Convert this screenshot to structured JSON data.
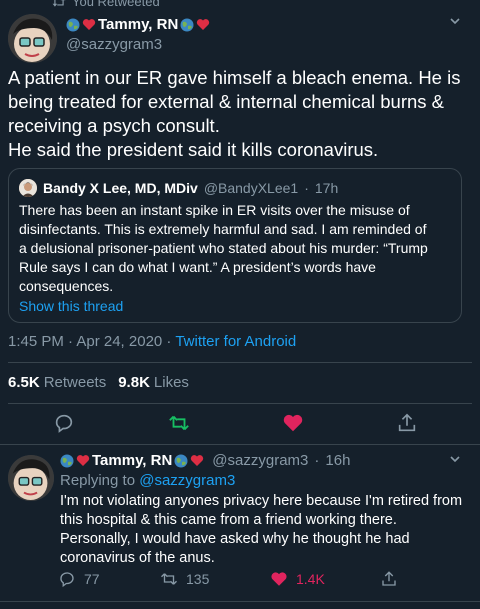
{
  "retweet_banner": {
    "text": "You Retweeted"
  },
  "main_tweet": {
    "display_name": "Tammy, RN",
    "handle": "@sazzygram3",
    "text_lines": [
      "A patient in our ER gave himself a bleach enema. He is",
      "being treated for external & internal chemical burns &",
      "receiving a psych consult.",
      "He said the president said it kills coronavirus."
    ],
    "quote": {
      "name": "Bandy X Lee, MD, MDiv",
      "handle": "@BandyXLee1",
      "time": "17h",
      "separator": "·",
      "body_lines": [
        "There has been an instant spike in ER visits over the misuse of",
        "disinfectants.  This is extremely harmful and sad.  I am reminded of",
        "a delusional prisoner-patient who stated about his murder: “Trump",
        "Rule says I can do what I want.”  A president’s words have",
        "consequences."
      ],
      "show_thread": "Show this thread"
    },
    "timestamp": "1:45 PM · Apr 24, 2020 · ",
    "client": "Twitter for Android",
    "retweets_count": "6.5K",
    "retweets_label": "Retweets",
    "likes_count": "9.8K",
    "likes_label": "Likes"
  },
  "reply_tweet": {
    "display_name": "Tammy, RN",
    "handle": "@sazzygram3",
    "time": "16h",
    "separator": "·",
    "replying_prefix": "Replying to ",
    "replying_to": "@sazzygram3",
    "text_lines": [
      "I'm not violating anyones privacy here because I'm retired from",
      "this hospital & this came from a friend working there.",
      "Personally, I would have asked why he thought he had",
      "coronavirus of the anus."
    ],
    "reply_count": "77",
    "retweet_count": "135",
    "like_count": "1.4K"
  },
  "colors": {
    "background": "#15202b",
    "muted": "#8899a6",
    "accent": "#1da1f2",
    "retweet_green": "#17bf63",
    "like_red": "#e0245e",
    "border": "#38444d"
  },
  "icons": [
    "retweet-icon",
    "globe-emoji",
    "heart-emoji",
    "chevron-down-icon",
    "reply-icon",
    "like-icon",
    "share-icon"
  ]
}
